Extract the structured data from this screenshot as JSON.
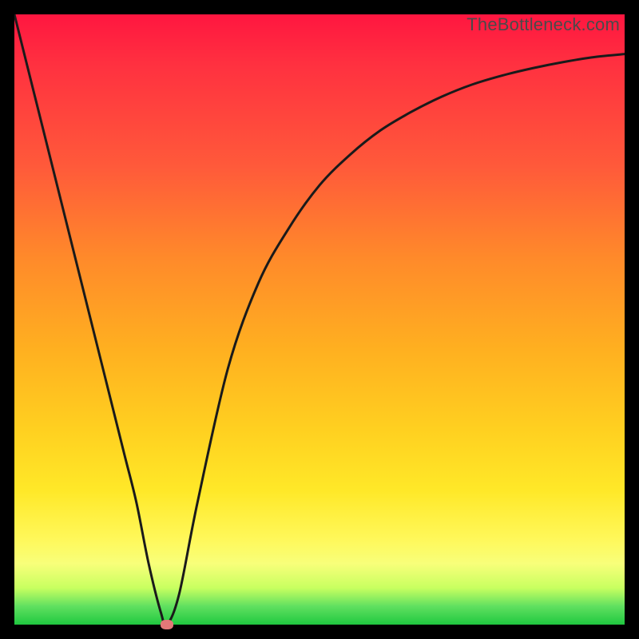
{
  "watermark": "TheBottleneck.com",
  "colors": {
    "curve_stroke": "#1a1a1a",
    "marker_fill": "#e27878"
  },
  "chart_data": {
    "type": "line",
    "title": "",
    "xlabel": "",
    "ylabel": "",
    "xlim": [
      0,
      100
    ],
    "ylim": [
      0,
      100
    ],
    "grid": false,
    "series": [
      {
        "name": "bottleneck-curve",
        "x": [
          0,
          5,
          10,
          15,
          18,
          20,
          22,
          24,
          25,
          27,
          30,
          35,
          40,
          45,
          50,
          55,
          60,
          65,
          70,
          75,
          80,
          85,
          90,
          95,
          100
        ],
        "values": [
          100,
          80,
          60,
          40,
          28,
          20,
          10,
          2,
          0,
          5,
          20,
          42,
          56,
          65,
          72,
          77,
          81,
          84,
          86.5,
          88.5,
          90,
          91.2,
          92.2,
          93,
          93.5
        ]
      }
    ],
    "marker": {
      "x": 25,
      "y": 0
    }
  }
}
